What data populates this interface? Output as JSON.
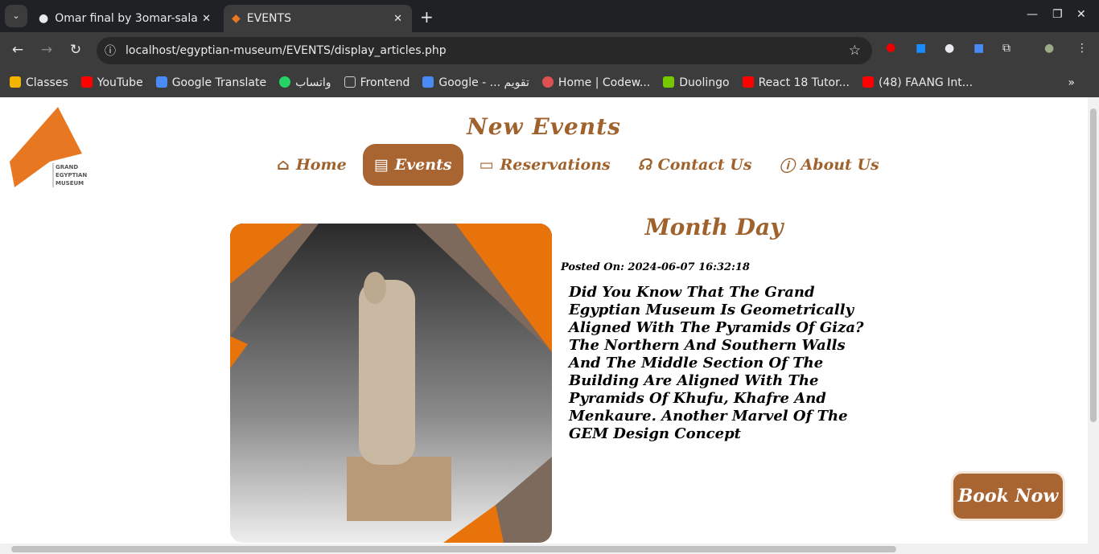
{
  "browser": {
    "tabs": [
      {
        "title": "Omar final by 3omar-sala"
      },
      {
        "title": "EVENTS"
      }
    ],
    "url": "localhost/egyptian-museum/EVENTS/display_articles.php",
    "bookmarks": [
      "Classes",
      "YouTube",
      "Google Translate",
      "واتساب",
      "Frontend",
      "Google - ... تقويم",
      "Home | Codew...",
      "Duolingo",
      "React 18 Tutor...",
      "(48) FAANG Int..."
    ]
  },
  "logo": {
    "text": "GRAND EGYPTIAN MUSEUM",
    "color": "#e87722"
  },
  "page": {
    "title": "New Events",
    "nav": [
      {
        "label": "Home",
        "icon": "home-icon"
      },
      {
        "label": "Events",
        "icon": "newspaper-icon",
        "active": true
      },
      {
        "label": "Reservations",
        "icon": "ticket-icon"
      },
      {
        "label": "Contact Us",
        "icon": "headset-icon"
      },
      {
        "label": "About Us",
        "icon": "info-icon"
      }
    ],
    "article": {
      "heading": "Month Day",
      "posted": "Posted On: 2024-06-07 16:32:18",
      "body": "Did You Know That The Grand Egyptian Museum Is Geometrically Aligned With The Pyramids Of Giza? The Northern And Southern Walls And The Middle Section Of The Building Are Aligned With The Pyramids Of Khufu, Khafre And Menkaure. Another Marvel Of The GEM Design Concept"
    },
    "book": "Book Now"
  },
  "colors": {
    "accent": "#a86431",
    "orange": "#e8730b"
  }
}
